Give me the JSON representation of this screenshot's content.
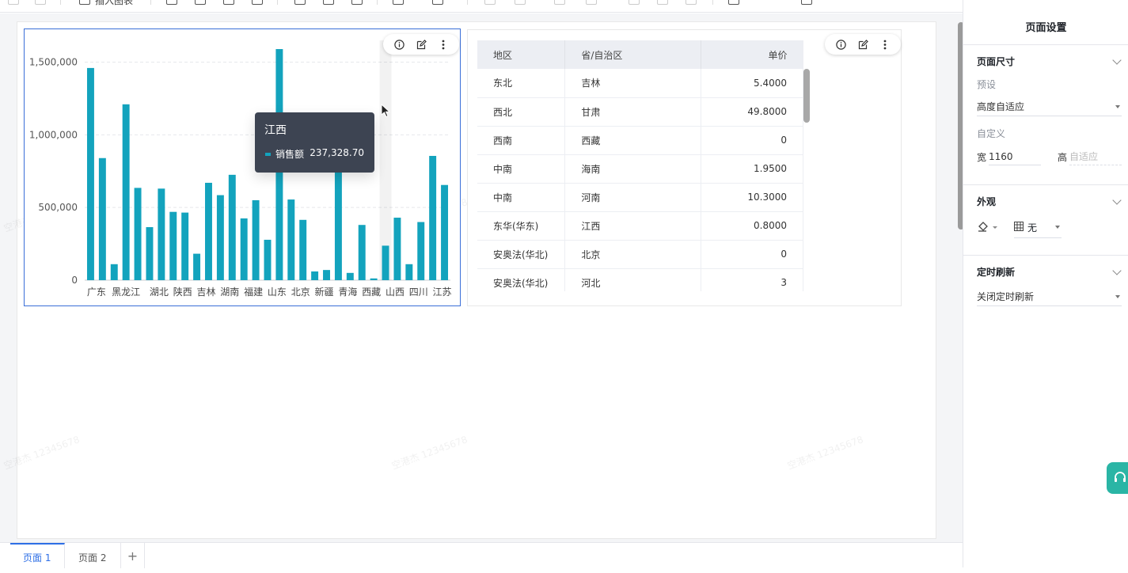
{
  "toolbar": {
    "insert_chart_label": "插入图表"
  },
  "chart_data": {
    "type": "bar",
    "categories": [
      "广东",
      "",
      "黑龙江",
      "",
      "",
      "湖北",
      "",
      "陕西",
      "",
      "吉林",
      "",
      "湖南",
      "",
      "福建",
      "",
      "山东",
      "",
      "北京",
      "",
      "新疆",
      "",
      "青海",
      "",
      "西藏",
      "",
      "山西",
      "",
      "四川",
      "江苏",
      ""
    ],
    "values": [
      1460000,
      840000,
      110000,
      1210000,
      635000,
      365000,
      630000,
      470000,
      465000,
      182000,
      670000,
      585000,
      725000,
      425000,
      550000,
      278000,
      1590000,
      555000,
      415000,
      60000,
      70000,
      800000,
      50000,
      380000,
      12000,
      237328.7,
      430000,
      110000,
      400000,
      855000,
      655000
    ],
    "category_labels": [
      "广东",
      "黑龙江",
      "湖北",
      "陕西",
      "吉林",
      "湖南",
      "福建",
      "山东",
      "北京",
      "新疆",
      "青海",
      "西藏",
      "山西",
      "四川",
      "江苏"
    ],
    "ytick_labels": [
      "1,500,000",
      "1,000,000",
      "500,000",
      "0"
    ],
    "ylim": [
      0,
      1650000
    ],
    "color": "#13a3bd",
    "highlight_index": 25,
    "grid": true
  },
  "tooltip": {
    "title": "江西",
    "series_name": "销售额",
    "value": "237,328.70"
  },
  "table": {
    "headers": [
      "地区",
      "省/自治区",
      "单价"
    ],
    "rows": [
      [
        "东北",
        "吉林",
        "5.4000"
      ],
      [
        "西北",
        "甘肃",
        "49.8000"
      ],
      [
        "西南",
        "西藏",
        "0"
      ],
      [
        "中南",
        "海南",
        "1.9500"
      ],
      [
        "中南",
        "河南",
        "10.3000"
      ],
      [
        "东华(华东)",
        "江西",
        "0.8000"
      ],
      [
        "安奥法(华北)",
        "北京",
        "0"
      ],
      [
        "安奥法(华北)",
        "河北",
        "3"
      ]
    ]
  },
  "panel": {
    "title": "页面设置",
    "page_size": {
      "title": "页面尺寸",
      "preset_label": "预设",
      "preset_value": "高度自适应",
      "custom_label": "自定义",
      "width_label": "宽",
      "width_value": "1160",
      "height_label": "高",
      "height_placeholder": "自适应"
    },
    "appearance": {
      "title": "外观",
      "border_value": "无"
    },
    "refresh": {
      "title": "定时刷新",
      "value": "关闭定时刷新"
    }
  },
  "tabs": [
    {
      "label": "页面 1",
      "active": true
    },
    {
      "label": "页面 2",
      "active": false
    }
  ],
  "tab_add_label": "+",
  "watermark_text": "空港杰 12345678"
}
